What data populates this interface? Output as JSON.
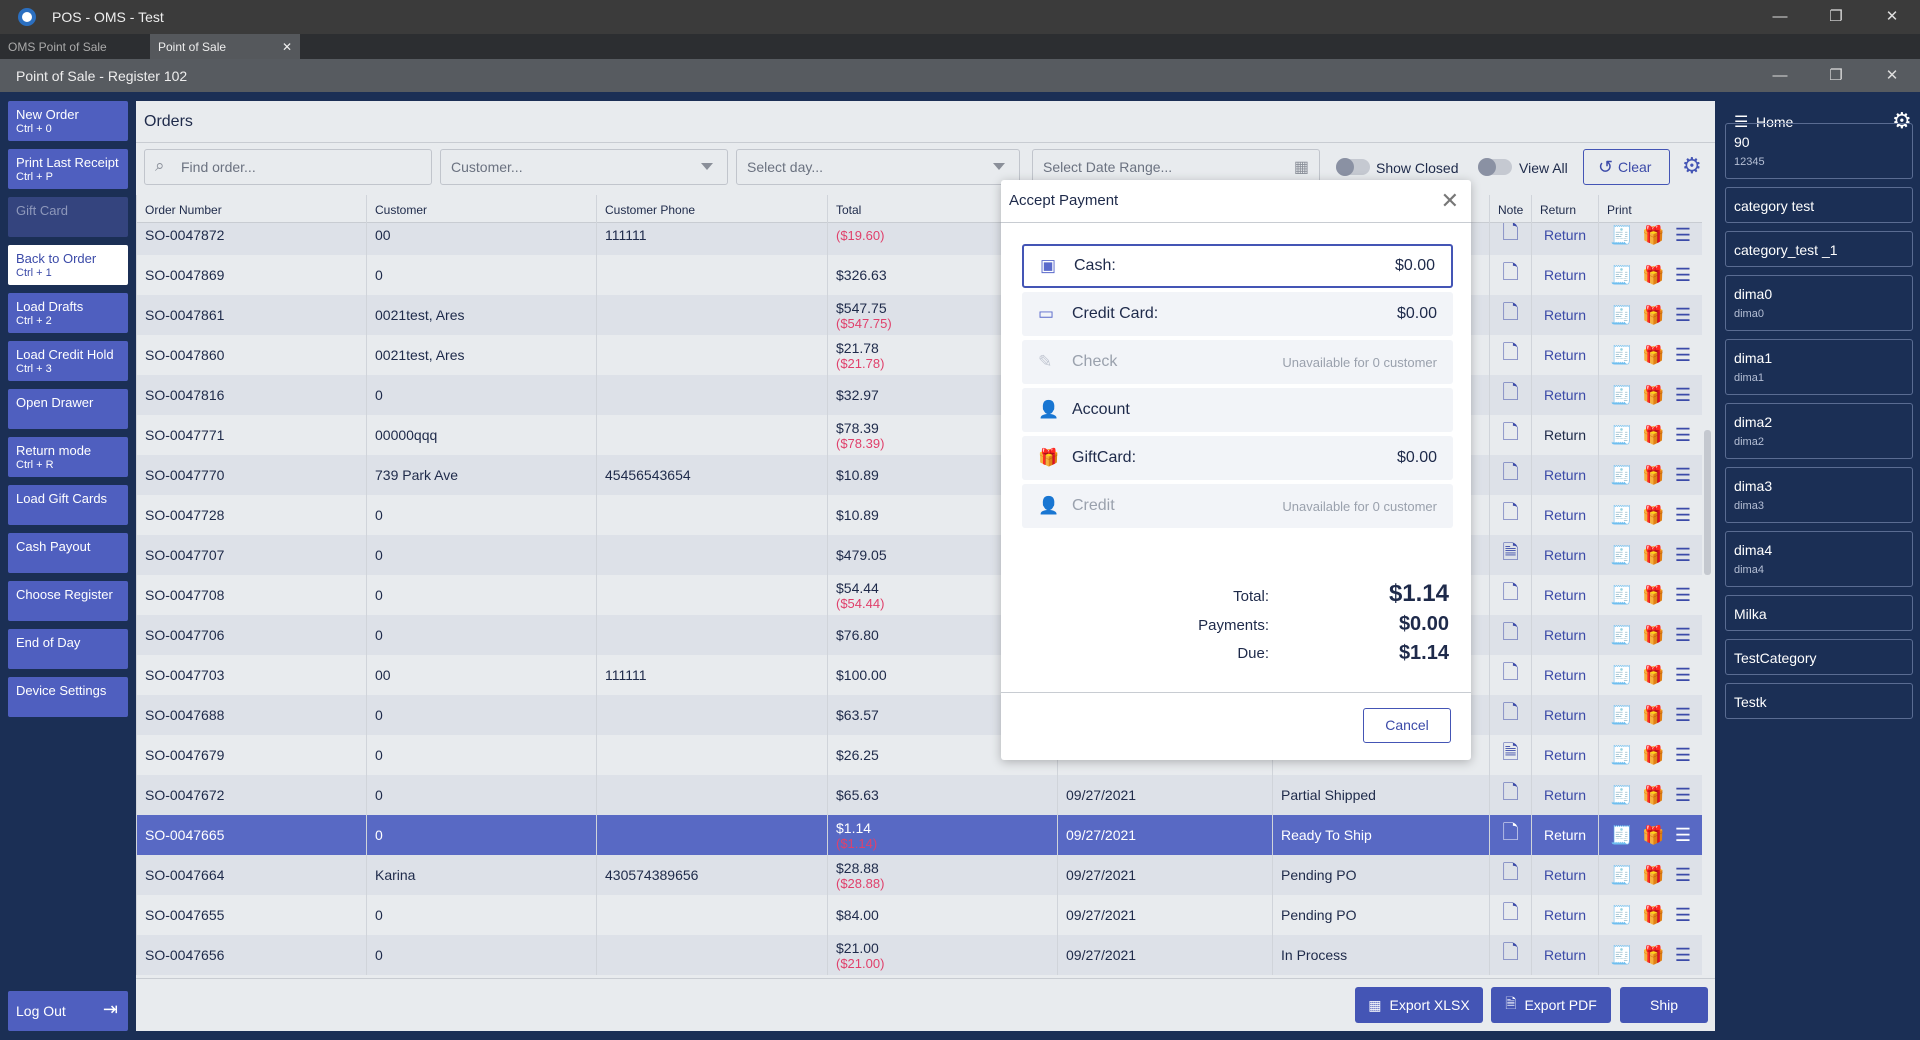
{
  "window": {
    "title": "POS - OMS - Test",
    "tabs": [
      "OMS Point of Sale",
      "Point of Sale"
    ],
    "subtitle": "Point of Sale - Register 102"
  },
  "sidebar": [
    {
      "label": "New Order",
      "shortcut": "Ctrl + 0"
    },
    {
      "label": "Print Last Receipt",
      "shortcut": "Ctrl + P"
    },
    {
      "label": "Gift Card",
      "shortcut": "",
      "disabled": true
    },
    {
      "label": "Back to Order",
      "shortcut": "Ctrl + 1",
      "light": true
    },
    {
      "label": "Load Drafts",
      "shortcut": "Ctrl + 2"
    },
    {
      "label": "Load Credit Hold",
      "shortcut": "Ctrl + 3"
    },
    {
      "label": "Open Drawer",
      "shortcut": ""
    },
    {
      "label": "Return mode",
      "shortcut": "Ctrl + R"
    },
    {
      "label": "Load Gift Cards",
      "shortcut": ""
    },
    {
      "label": "Cash Payout",
      "shortcut": ""
    },
    {
      "label": "Choose Register",
      "shortcut": ""
    },
    {
      "label": "End of Day",
      "shortcut": ""
    },
    {
      "label": "Device Settings",
      "shortcut": ""
    }
  ],
  "logout": "Log Out",
  "orders": {
    "title": "Orders",
    "find_placeholder": "Find order...",
    "customer_placeholder": "Customer...",
    "day_placeholder": "Select day...",
    "date_range_placeholder": "Select Date Range...",
    "show_closed": "Show Closed",
    "view_all": "View All",
    "clear": "Clear",
    "columns": [
      "Order Number",
      "Customer",
      "Customer Phone",
      "Total",
      "",
      "",
      "Note",
      "Return",
      "Print"
    ],
    "return_label": "Return",
    "rows": [
      {
        "order": "SO-0047872",
        "customer": "00",
        "phone": "111111",
        "total": "",
        "refund": "($19.60)",
        "note": "plus"
      },
      {
        "order": "SO-0047869",
        "customer": "0",
        "phone": "",
        "total": "$326.63",
        "refund": "",
        "note": "plus"
      },
      {
        "order": "SO-0047861",
        "customer": "0021test, Ares",
        "phone": "",
        "total": "$547.75",
        "refund": "($547.75)",
        "note": "plus"
      },
      {
        "order": "SO-0047860",
        "customer": "0021test, Ares",
        "phone": "",
        "total": "$21.78",
        "refund": "($21.78)",
        "note": "plus"
      },
      {
        "order": "SO-0047816",
        "customer": "0",
        "phone": "",
        "total": "$32.97",
        "refund": "",
        "note": "plus"
      },
      {
        "order": "SO-0047771",
        "customer": "00000qqq",
        "phone": "",
        "total": "$78.39",
        "refund": "($78.39)",
        "note": "plus",
        "return_plain": true
      },
      {
        "order": "SO-0047770",
        "customer": "739 Park Ave",
        "phone": "45456543654",
        "total": "$10.89",
        "refund": "",
        "note": "plus"
      },
      {
        "order": "SO-0047728",
        "customer": "0",
        "phone": "",
        "total": "$10.89",
        "refund": "",
        "note": "plus"
      },
      {
        "order": "SO-0047707",
        "customer": "0",
        "phone": "",
        "total": "$479.05",
        "refund": "",
        "note": "lines"
      },
      {
        "order": "SO-0047708",
        "customer": "0",
        "phone": "",
        "total": "$54.44",
        "refund": "($54.44)",
        "note": "plus"
      },
      {
        "order": "SO-0047706",
        "customer": "0",
        "phone": "",
        "total": "$76.80",
        "refund": "",
        "note": "plus"
      },
      {
        "order": "SO-0047703",
        "customer": "00",
        "phone": "111111",
        "total": "$100.00",
        "refund": "",
        "note": "plus"
      },
      {
        "order": "SO-0047688",
        "customer": "0",
        "phone": "",
        "total": "$63.57",
        "refund": "",
        "note": "plus"
      },
      {
        "order": "SO-0047679",
        "customer": "0",
        "phone": "",
        "total": "$26.25",
        "refund": "",
        "note": "lines"
      },
      {
        "order": "SO-0047672",
        "customer": "0",
        "phone": "",
        "total": "$65.63",
        "refund": "",
        "date": "09/27/2021",
        "status": "Partial Shipped",
        "note": "plus"
      },
      {
        "order": "SO-0047665",
        "customer": "0",
        "phone": "",
        "total": "$1.14",
        "refund": "($1.14)",
        "date": "09/27/2021",
        "status": "Ready To Ship",
        "note": "plus",
        "selected": true
      },
      {
        "order": "SO-0047664",
        "customer": "Karina",
        "phone": "430574389656",
        "total": "$28.88",
        "refund": "($28.88)",
        "date": "09/27/2021",
        "status": "Pending PO",
        "note": "plus"
      },
      {
        "order": "SO-0047655",
        "customer": "0",
        "phone": "",
        "total": "$84.00",
        "refund": "",
        "date": "09/27/2021",
        "status": "Pending PO",
        "note": "plus"
      },
      {
        "order": "SO-0047656",
        "customer": "0",
        "phone": "",
        "total": "$21.00",
        "refund": "($21.00)",
        "date": "09/27/2021",
        "status": "In Process",
        "note": "plus"
      }
    ],
    "export_xlsx": "Export XLSX",
    "export_pdf": "Export PDF",
    "ship": "Ship"
  },
  "right_panel": {
    "home": "Home",
    "categories": [
      {
        "name": "90",
        "sub": "12345"
      },
      {
        "name": "category test",
        "sub": ""
      },
      {
        "name": "category_test _1",
        "sub": ""
      },
      {
        "name": "dima0",
        "sub": "dima0"
      },
      {
        "name": "dima1",
        "sub": "dima1"
      },
      {
        "name": "dima2",
        "sub": "dima2"
      },
      {
        "name": "dima3",
        "sub": "dima3"
      },
      {
        "name": "dima4",
        "sub": "dima4"
      },
      {
        "name": "Milka",
        "sub": ""
      },
      {
        "name": "TestCategory",
        "sub": ""
      },
      {
        "name": "Testk",
        "sub": ""
      }
    ]
  },
  "modal": {
    "title": "Accept Payment",
    "methods": [
      {
        "icon": "cash-icon",
        "label": "Cash:",
        "amount": "$0.00",
        "active": true
      },
      {
        "icon": "credit-card-icon",
        "label": "Credit Card:",
        "amount": "$0.00"
      },
      {
        "icon": "check-icon",
        "label": "Check",
        "amount": "Unavailable for 0 customer",
        "disabled": true
      },
      {
        "icon": "account-icon",
        "label": "Account",
        "amount": ""
      },
      {
        "icon": "gift-card-icon",
        "label": "GiftCard:",
        "amount": "$0.00"
      },
      {
        "icon": "credit-icon",
        "label": "Credit",
        "amount": "Unavailable for 0 customer",
        "disabled": true
      }
    ],
    "total_label": "Total:",
    "total": "$1.14",
    "payments_label": "Payments:",
    "payments": "$0.00",
    "due_label": "Due:",
    "due": "$1.14",
    "cancel": "Cancel"
  },
  "colors": {
    "accent": "#4455b5",
    "selected_row": "#5869c4",
    "navy": "#1b2f55",
    "negative": "#e0406b"
  }
}
